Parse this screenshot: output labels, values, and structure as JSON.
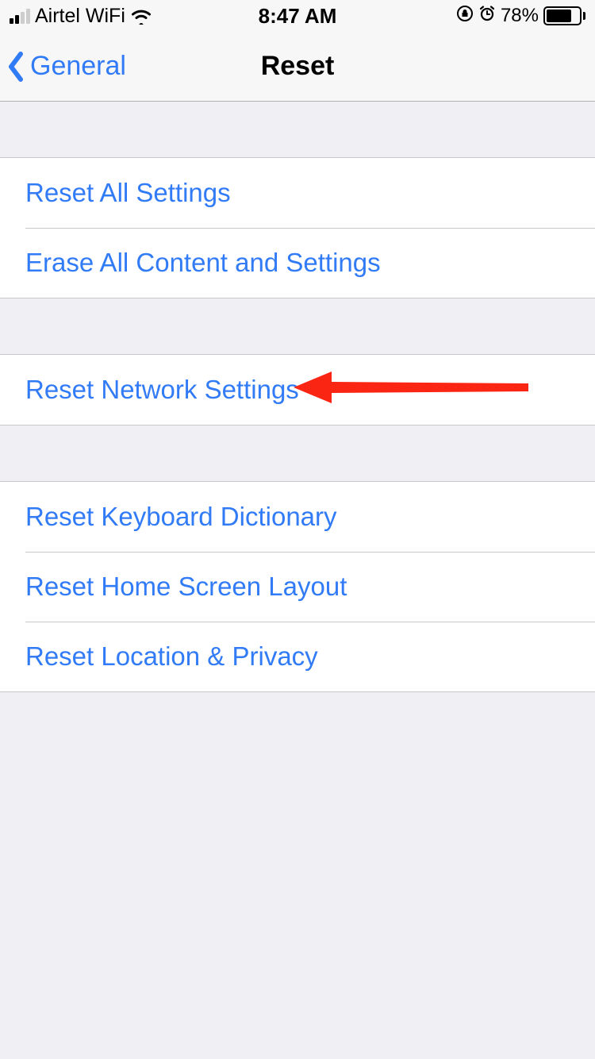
{
  "statusbar": {
    "carrier": "Airtel WiFi",
    "time": "8:47 AM",
    "battery_pct": "78%"
  },
  "nav": {
    "back_label": "General",
    "title": "Reset"
  },
  "rows": {
    "reset_all": "Reset All Settings",
    "erase_all": "Erase All Content and Settings",
    "reset_network": "Reset Network Settings",
    "reset_keyboard": "Reset Keyboard Dictionary",
    "reset_home": "Reset Home Screen Layout",
    "reset_location": "Reset Location & Privacy"
  },
  "colors": {
    "link": "#327bf6",
    "bg": "#efeff4",
    "arrow": "#fb2513"
  }
}
